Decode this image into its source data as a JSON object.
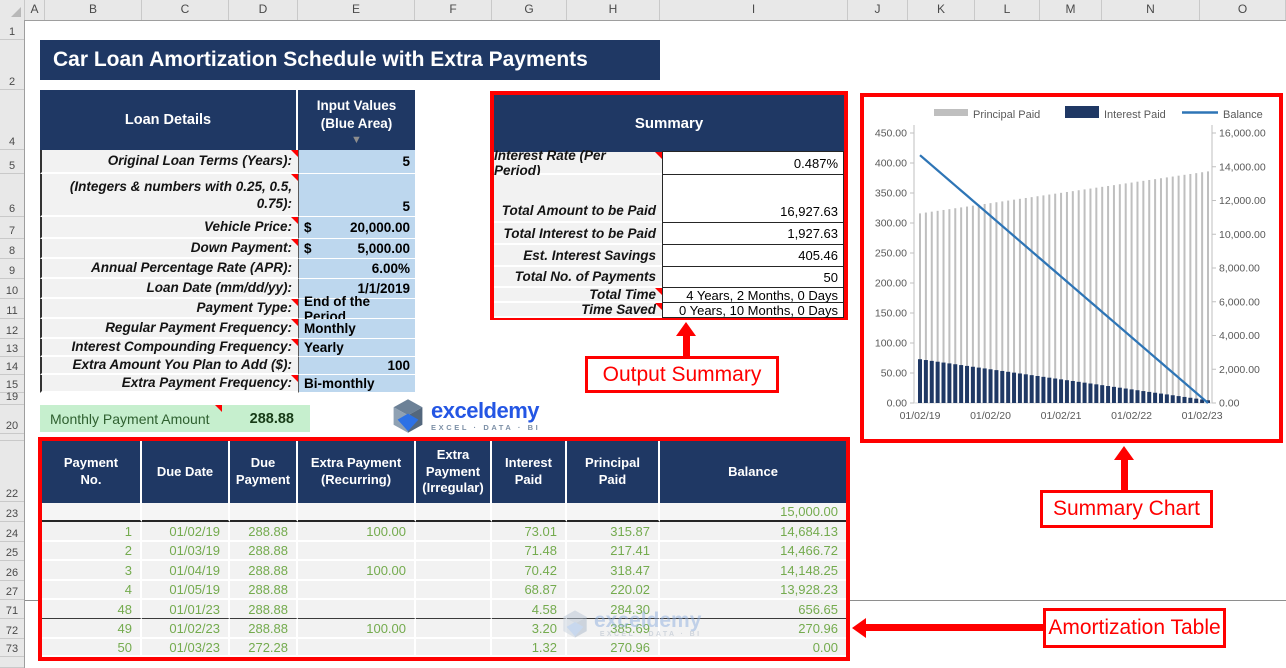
{
  "title": "Car Loan Amortization Schedule with Extra Payments",
  "spreadsheet": {
    "column_headers": [
      "A",
      "B",
      "C",
      "D",
      "E",
      "F",
      "G",
      "H",
      "I",
      "J",
      "K",
      "L",
      "M",
      "N",
      "O"
    ],
    "row_numbers": [
      "1",
      "2",
      "4",
      "5",
      "6",
      "7",
      "8",
      "9",
      "10",
      "11",
      "12",
      "13",
      "14",
      "15",
      "19",
      "20",
      "",
      "22",
      "23",
      "24",
      "25",
      "26",
      "27",
      "71",
      "72",
      "73",
      ""
    ]
  },
  "loan_details": {
    "header": "Loan Details",
    "input_header_1": "Input Values",
    "input_header_2": "(Blue Area)",
    "rows": [
      {
        "label": "Original Loan Terms (Years):",
        "value": "5",
        "align": "right",
        "note": true
      },
      {
        "label": "(Integers & numbers with 0.25, 0.5, 0.75):",
        "value": "5",
        "align": "right",
        "note": true,
        "valign": "bottom"
      },
      {
        "label": "Vehicle Price:",
        "prefix": "$",
        "value": "20,000.00",
        "align": "money",
        "note": true
      },
      {
        "label": "Down Payment:",
        "prefix": "$",
        "value": "5,000.00",
        "align": "money",
        "note": true
      },
      {
        "label": "Annual Percentage Rate (APR):",
        "value": "6.00%",
        "align": "right"
      },
      {
        "label": "Loan Date (mm/dd/yy):",
        "value": "1/1/2019",
        "align": "right"
      },
      {
        "label": "Payment Type:",
        "value": "End of the Period",
        "align": "left",
        "note": true
      },
      {
        "label": "Regular Payment Frequency:",
        "value": "Monthly",
        "align": "left",
        "note": true
      },
      {
        "label": "Interest Compounding Frequency:",
        "value": "Yearly",
        "align": "left",
        "note": true
      },
      {
        "label": "Extra Amount You Plan to Add ($):",
        "value": "100",
        "align": "right"
      },
      {
        "label": "Extra Payment Frequency:",
        "value": "Bi-monthly",
        "align": "left",
        "note": true
      }
    ]
  },
  "monthly_payment": {
    "label": "Monthly Payment Amount",
    "value": "288.88"
  },
  "logo": {
    "wordmark": "exceldemy",
    "tagline": "EXCEL · DATA · BI"
  },
  "summary": {
    "header": "Summary",
    "rows": [
      {
        "label": "Interest Rate (Per Period)",
        "value": "0.487%",
        "note": true
      },
      {
        "label": "Total Amount to be Paid",
        "value": "16,927.63",
        "tall": true
      },
      {
        "label": "Total Interest to be Paid",
        "value": "1,927.63"
      },
      {
        "label": "Est. Interest Savings",
        "value": "405.46"
      },
      {
        "label": "Total No. of Payments",
        "value": "50"
      },
      {
        "label": "Total Time",
        "value": "4 Years, 2 Months, 0 Days",
        "note": true
      },
      {
        "label": "Time Saved",
        "value": "0 Years, 10 Months, 0 Days",
        "note": true
      }
    ]
  },
  "callouts": {
    "output_summary": "Output Summary",
    "summary_chart": "Summary Chart",
    "amortization_table": "Amortization Table"
  },
  "amortization": {
    "headers": [
      "Payment No.",
      "Due Date",
      "Due Payment",
      "Extra Payment (Recurring)",
      "Extra Payment (Irregular)",
      "Interest Paid",
      "Principal Paid",
      "Balance"
    ],
    "rows": [
      [
        "",
        "",
        "",
        "",
        "",
        "",
        "",
        "15,000.00"
      ],
      [
        "1",
        "01/02/19",
        "288.88",
        "100.00",
        "",
        "73.01",
        "315.87",
        "14,684.13"
      ],
      [
        "2",
        "01/03/19",
        "288.88",
        "",
        "",
        "71.48",
        "217.41",
        "14,466.72"
      ],
      [
        "3",
        "01/04/19",
        "288.88",
        "100.00",
        "",
        "70.42",
        "318.47",
        "14,148.25"
      ],
      [
        "4",
        "01/05/19",
        "288.88",
        "",
        "",
        "68.87",
        "220.02",
        "13,928.23"
      ],
      [
        "48",
        "01/01/23",
        "288.88",
        "",
        "",
        "4.58",
        "284.30",
        "656.65"
      ],
      [
        "49",
        "01/02/23",
        "288.88",
        "100.00",
        "",
        "3.20",
        "385.69",
        "270.96"
      ],
      [
        "50",
        "01/03/23",
        "272.28",
        "",
        "",
        "1.32",
        "270.96",
        "0.00"
      ]
    ]
  },
  "chart_data": {
    "type": "bar",
    "title": "",
    "legend": [
      "Principal Paid",
      "Interest Paid",
      "Balance"
    ],
    "legend_position": "top",
    "colors": {
      "principal": "#BFBFBF",
      "interest": "#1F3864",
      "balance": "#2E75B6"
    },
    "x_tick_labels": [
      "01/02/19",
      "01/02/20",
      "01/02/21",
      "01/02/22",
      "01/02/23"
    ],
    "x_tick_positions": [
      0,
      12,
      24,
      36,
      48
    ],
    "left_axis": {
      "min": 0,
      "max": 450,
      "step": 50
    },
    "right_axis": {
      "min": 0,
      "max": 16000,
      "step": 2000
    },
    "grid": false,
    "series": [
      {
        "name": "Principal Paid",
        "type": "bar",
        "axis": "left",
        "values": [
          316,
          317.4,
          318.9,
          320.3,
          321.7,
          323.1,
          324.6,
          326,
          327.4,
          328.9,
          330.3,
          331.7,
          333.1,
          334.6,
          336,
          337.4,
          338.9,
          340.3,
          341.7,
          343.1,
          344.6,
          346,
          347.4,
          348.9,
          350.3,
          351.7,
          353.1,
          354.6,
          356,
          357.4,
          358.9,
          360.3,
          361.7,
          363.1,
          364.6,
          366,
          367.4,
          368.9,
          370.3,
          371.7,
          373.1,
          374.6,
          376,
          377.4,
          378.9,
          380.3,
          381.7,
          383.1,
          384.6,
          386
        ]
      },
      {
        "name": "Interest Paid",
        "type": "bar",
        "axis": "left",
        "values": [
          73,
          71.6,
          70.2,
          68.8,
          67.4,
          66,
          64.6,
          63.2,
          61.8,
          60.4,
          59,
          57.6,
          56.2,
          54.8,
          53.4,
          52,
          50.6,
          49.2,
          47.8,
          46.4,
          45,
          43.6,
          42.2,
          40.8,
          39.4,
          38,
          36.7,
          35.3,
          33.9,
          32.5,
          31.1,
          29.7,
          28.3,
          26.9,
          25.5,
          24.1,
          22.7,
          21.3,
          19.9,
          18.5,
          17.1,
          15.7,
          14.3,
          12.9,
          11.5,
          10.1,
          8.7,
          7.3,
          5.9,
          4.5
        ]
      },
      {
        "name": "Balance",
        "type": "line",
        "axis": "right",
        "values": [
          14684,
          14384,
          14085,
          13785,
          13485,
          13186,
          12886,
          12586,
          12287,
          11987,
          11687,
          11388,
          11088,
          10788,
          10489,
          10189,
          9889,
          9590,
          9290,
          8990,
          8691,
          8391,
          8091,
          7792,
          7492,
          7192,
          6893,
          6593,
          6293,
          5994,
          5694,
          5394,
          5095,
          4795,
          4495,
          4196,
          3896,
          3596,
          3297,
          2997,
          2697,
          2398,
          2098,
          1798,
          1499,
          1199,
          899,
          600,
          300,
          0
        ]
      }
    ]
  }
}
